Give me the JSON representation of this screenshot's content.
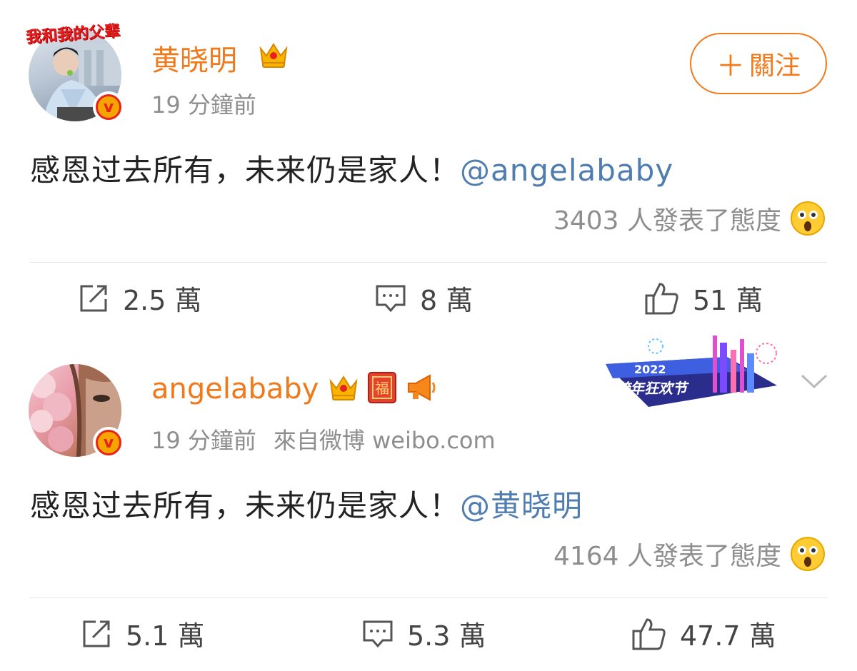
{
  "posts": [
    {
      "avatar_caption": "我和我的父辈",
      "username": "黄晓明",
      "time": "19 分鐘前",
      "source": "",
      "content_text": "感恩过去所有，未来仍是家人！",
      "mention": "@angelababy",
      "reactions_text": "3403 人發表了態度",
      "follow_label": "關注",
      "reposts": "2.5 萬",
      "comments": "8 萬",
      "likes": "51 萬",
      "icons": [
        "crown-icon"
      ]
    },
    {
      "username": "angelababy",
      "time": "19 分鐘前",
      "source": "來自微博 weibo.com",
      "content_text": "感恩过去所有，未来仍是家人！",
      "mention": "@黄晓明",
      "reactions_text": "4164 人發表了態度",
      "banner_year": "2022",
      "banner_title": "跨年狂欢节",
      "reposts": "5.1 萬",
      "comments": "5.3 萬",
      "likes": "47.7 萬",
      "icons": [
        "crown-icon",
        "fu-icon",
        "megaphone-icon"
      ]
    }
  ],
  "colors": {
    "username": "#f07a1b",
    "mention": "#507daf",
    "meta": "#8e8e8e"
  }
}
